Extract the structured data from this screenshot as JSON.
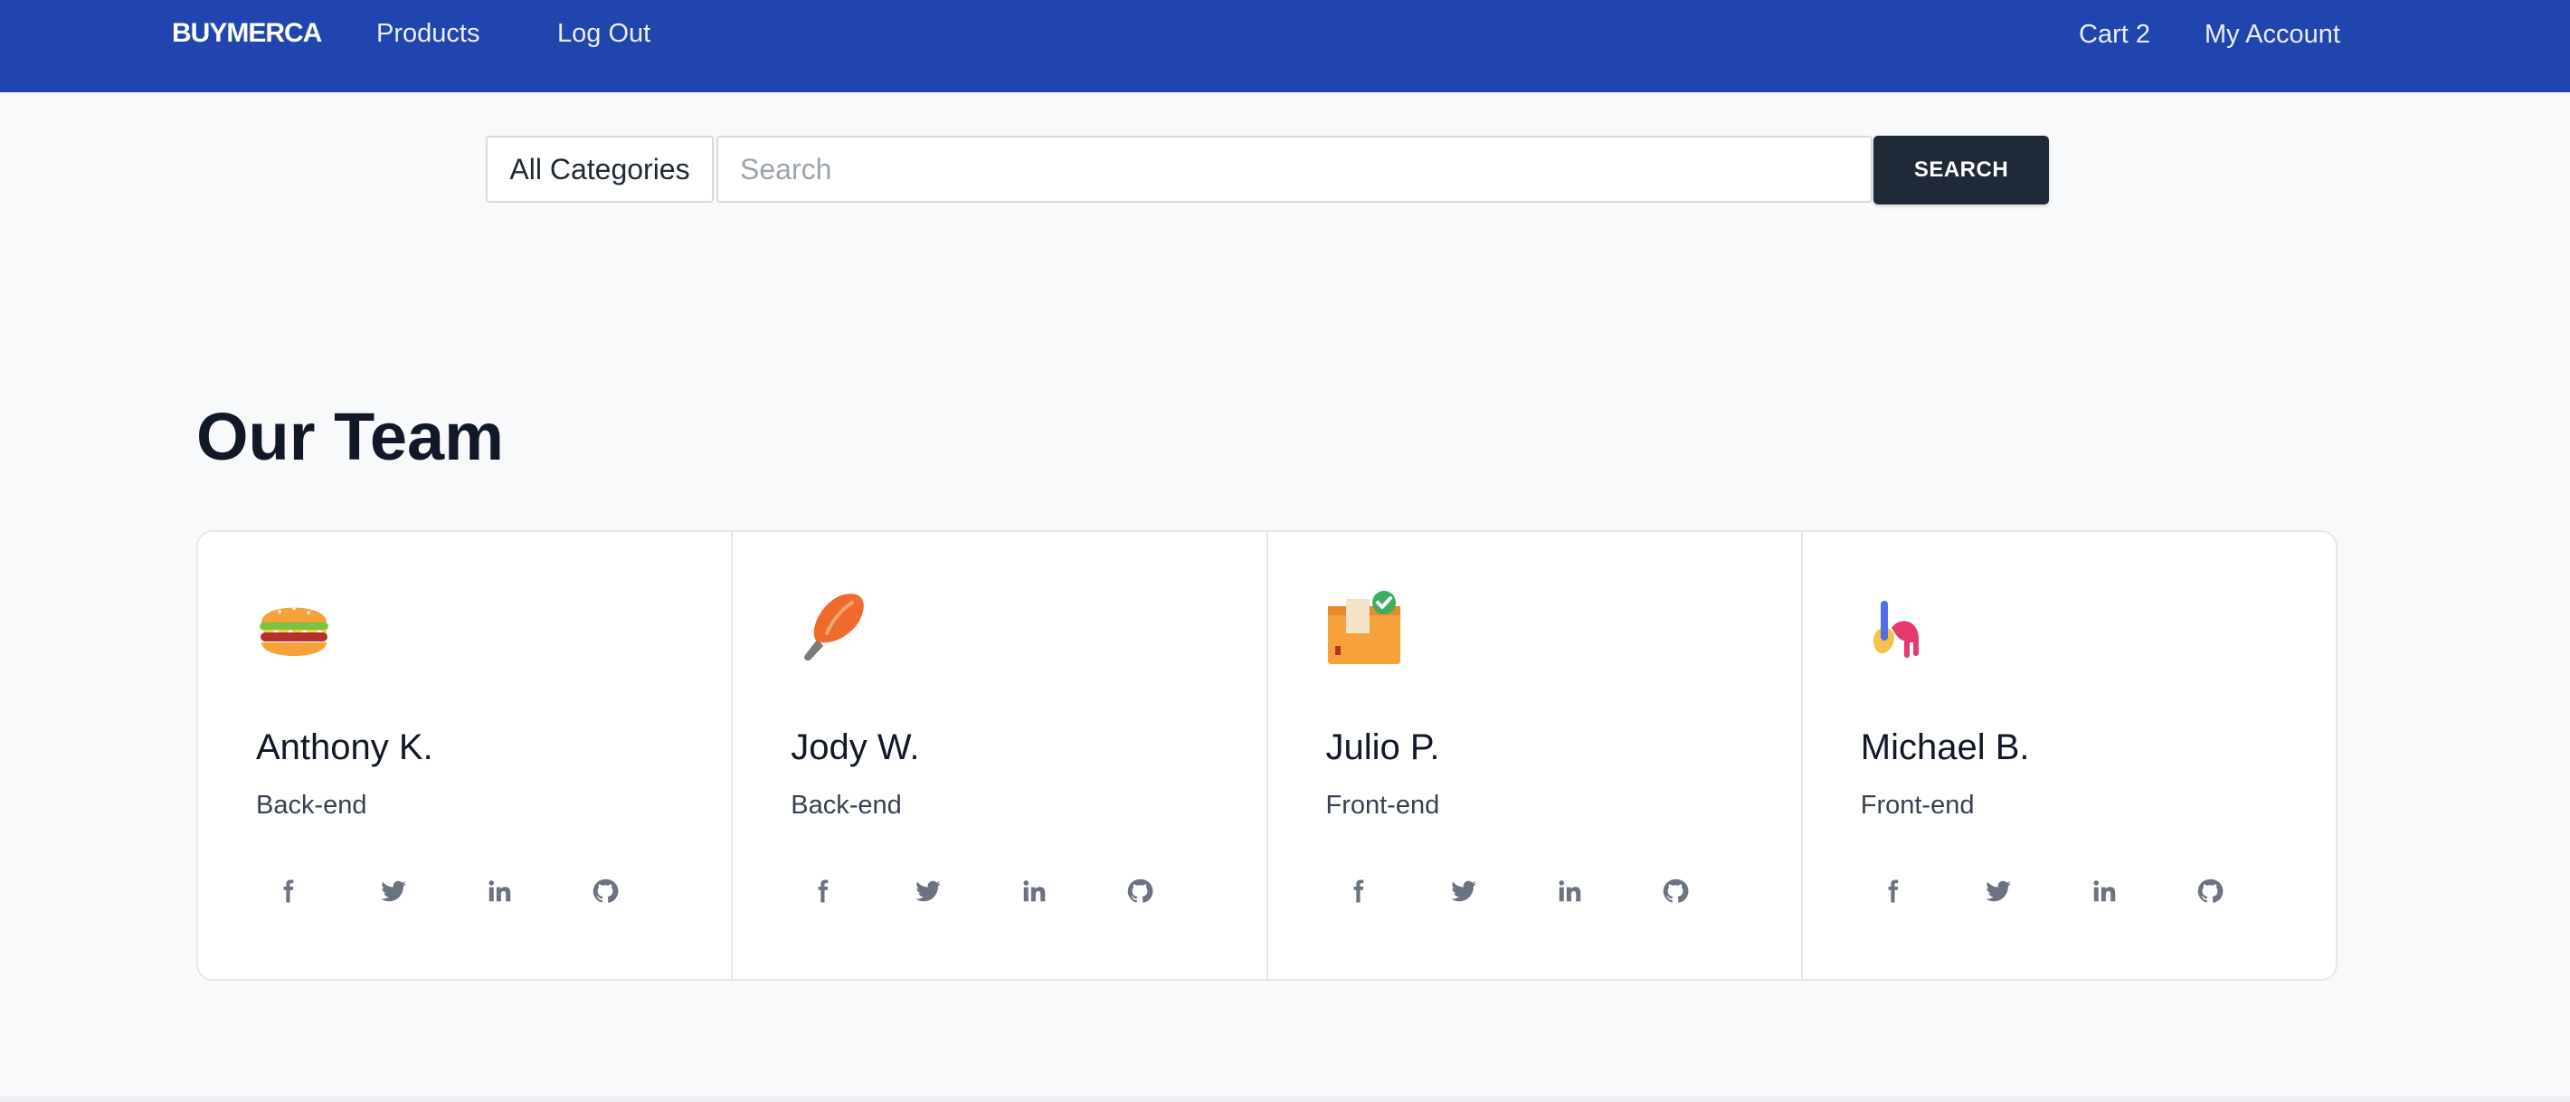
{
  "nav": {
    "brand": "BUYMERCA",
    "products": "Products",
    "logout": "Log Out",
    "cart": "Cart 2",
    "account": "My Account",
    "bg_color": "#2145ae"
  },
  "search": {
    "category": "All Categories",
    "placeholder": "Search",
    "button": "SEARCH"
  },
  "page": {
    "title": "Our Team"
  },
  "team": [
    {
      "name": "Anthony K.",
      "role": "Back-end",
      "avatar_icon": "burger-icon"
    },
    {
      "name": "Jody W.",
      "role": "Back-end",
      "avatar_icon": "popsicle-icon"
    },
    {
      "name": "Julio P.",
      "role": "Front-end",
      "avatar_icon": "box-check-icon"
    },
    {
      "name": "Michael B.",
      "role": "Front-end",
      "avatar_icon": "paint-hand-icon"
    }
  ],
  "social_icons": [
    "facebook-icon",
    "twitter-icon",
    "linkedin-icon",
    "github-icon"
  ]
}
